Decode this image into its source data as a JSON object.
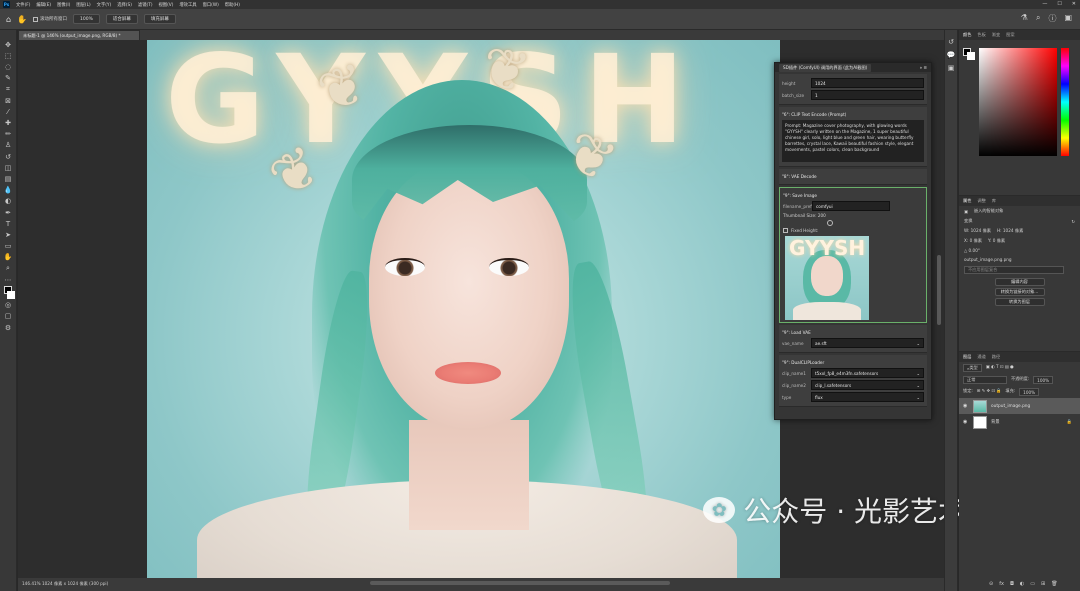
{
  "menubar": {
    "items": [
      "文件(F)",
      "编辑(E)",
      "图像(I)",
      "图层(L)",
      "文字(Y)",
      "选择(S)",
      "滤镜(T)",
      "视图(V)",
      "增效工具",
      "窗口(W)",
      "帮助(H)"
    ]
  },
  "options": {
    "scroll_all": "滚动所有窗口",
    "zoom": "100%",
    "fit_screen": "适合屏幕",
    "fill_screen": "填充屏幕"
  },
  "document": {
    "tab_title": "未标题-1 @ 146% (output_image.png, RGB/8) *",
    "status": "146.41%  1024 像素 x 1024 像素 (300 ppi)"
  },
  "watermark": {
    "text": "公众号 · 光影艺术生活馆"
  },
  "canvas": {
    "headline": "GYYSH"
  },
  "plugin": {
    "title": "SD插件 (ComfyUI) 调用的界面 (此为AI截图) ",
    "height_label": "height",
    "height_value": "1024",
    "batch_label": "batch_size",
    "batch_value": "1",
    "clip_title": "\"6\": CLIP Text Encode (Prompt)",
    "prompt": "Prompt: Magazine cover photography, with glowing words \"GYYSH\" clearly written on the Magazine, 1 super beautiful chinese girl, solo,  light blue and green hair, wearing butterfly barrettes, crystal lace, Kawaii beautiful fashion style, elegant movements, pastel colors, clean background",
    "vae_title": "\"8\": VAE Decode",
    "save_title": "\"9\": Save Image",
    "prefix_label": "filename_prefix",
    "prefix_value": "comfyui",
    "thumb_label": "Thumbnail Size: 200",
    "fixed_height": "Fixed Height:",
    "preview_text": "GYYSH",
    "loadvae_title": "\"9\": Load VAE",
    "vae_name_label": "vae_name",
    "vae_name_value": "ae.sft",
    "dualclip_title": "\"9\": DualCLIPLoader",
    "clip1_label": "clip_name1",
    "clip1_value": "t5xxl_fp8_e4m3fn.safetensors",
    "clip2_label": "clip_name2",
    "clip2_value": "clip_l.safetensors",
    "type_label": "type",
    "type_value": "flux"
  },
  "color_panel": {
    "tabs": [
      "颜色",
      "色板",
      "渐变",
      "图案"
    ]
  },
  "properties": {
    "tabs": [
      "属性",
      "调整",
      "库"
    ],
    "object_label": "嵌入的智能对象",
    "transform": "变换",
    "w": "W:  1024 像素",
    "h": "H:  1024 像素",
    "x": "X:  0 像素",
    "y": "Y:  0 像素",
    "angle": "△  0.00°",
    "filename": "output_image.png.png",
    "layer_comp": "不应用图层复合",
    "btn1": "编辑内容",
    "btn2": "转换为链接的对象...",
    "btn3": "转换为图层"
  },
  "layers": {
    "tabs": [
      "图层",
      "通道",
      "路径"
    ],
    "kind_label": "类型",
    "blend": "正常",
    "opacity_label": "不透明度:",
    "opacity": "100%",
    "lock_label": "锁定:",
    "fill_label": "填充:",
    "fill": "100%",
    "items": [
      {
        "name": "output_image.png"
      },
      {
        "name": "背景"
      }
    ]
  }
}
